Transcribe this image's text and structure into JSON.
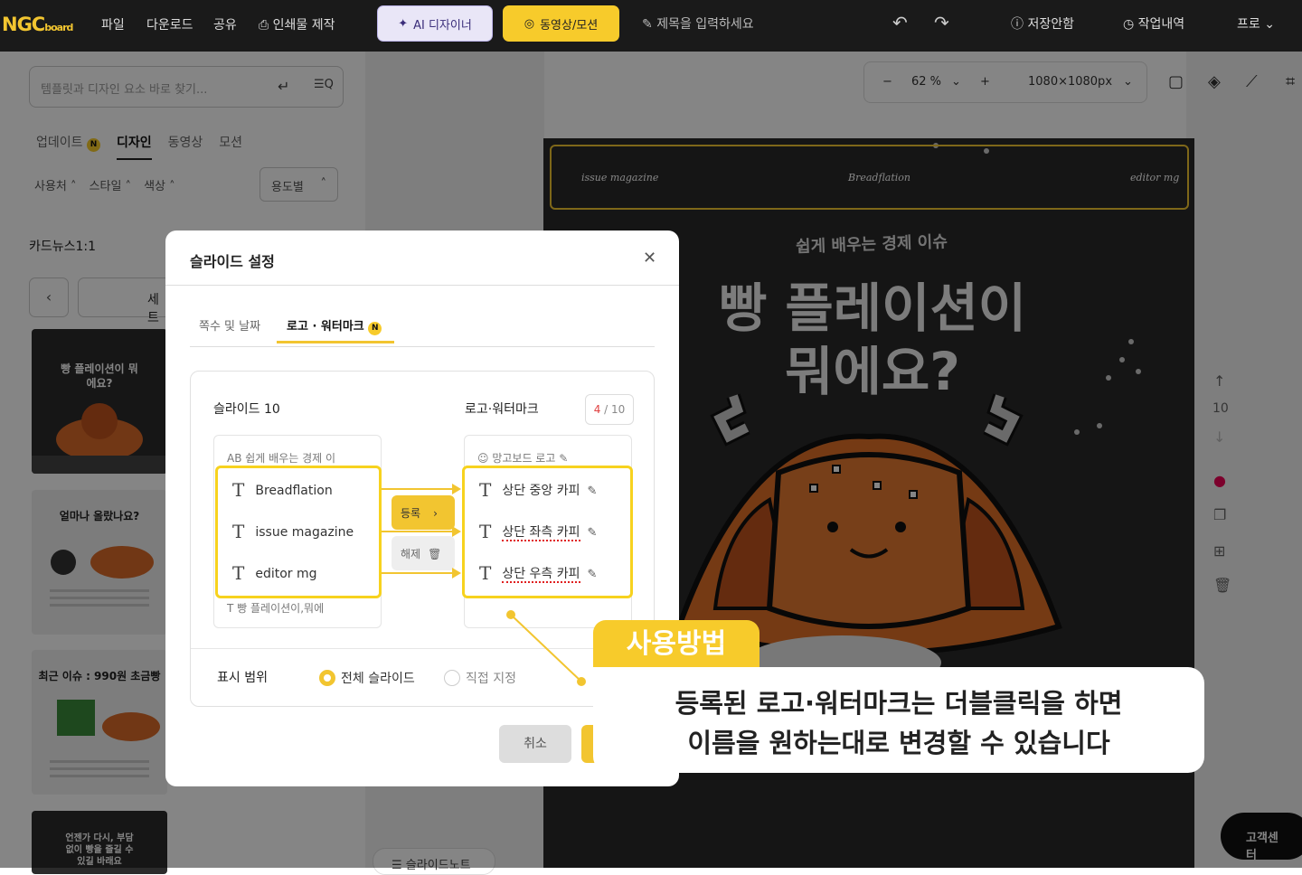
{
  "topbar": {
    "logo_main": "NGC",
    "logo_sub": "board",
    "menu": [
      "파일",
      "다운로드",
      "공유",
      "인쇄물 제작"
    ],
    "ai_designer": "AI 디자이너",
    "video_motion": "동영상/모션",
    "title_placeholder": "제목을 입력하세요",
    "not_saved": "저장안함",
    "history": "작업내역",
    "pro": "프로"
  },
  "sidebar": {
    "search_placeholder": "템플릿과 디자인 요소 바로 찾기...",
    "tabs": [
      "업데이트",
      "디자인",
      "동영상",
      "모션"
    ],
    "tab_badge": "N",
    "filters": [
      "사용처",
      "스타일",
      "색상"
    ],
    "usage": "용도별",
    "category": "카드뉴스1:1",
    "set_label": "세트",
    "thumbs": [
      {
        "title": "빵 플레이션이 뭐에요?"
      },
      {
        "title": "얼마나 올랐나요?"
      },
      {
        "title": "최근 이슈 : 990원 초금빵"
      },
      {
        "title": "언젠가 다시, 부담 없이 빵을 즐길 수 있길 바래요"
      }
    ]
  },
  "canvas": {
    "zoom": "62 %",
    "size": "1080×1080px",
    "logo_left": "issue magazine",
    "logo_center": "Breadflation",
    "logo_right": "editor mg",
    "subtitle": "쉽게 배우는 경제 이슈",
    "title_line1": "빵 플레이션이",
    "title_line2": "뭐에요?",
    "page_num": "10",
    "slide_note": "슬라이드노트",
    "help": "고객센터"
  },
  "modal": {
    "title": "슬라이드 설정",
    "tabs": [
      "쪽수 및 날짜",
      "로고 · 워터마크"
    ],
    "tab_badge": "N",
    "slide_col": "슬라이드 10",
    "logo_col": "로고·워터마크",
    "count_used": "4",
    "count_total": "/ 10",
    "slide_items_bg": [
      "쉽게 배우는 경제 이",
      "빵 플레이션이,뭐에"
    ],
    "logo_item_bg": "망고보드 로고",
    "register": "등록",
    "remove": "해제",
    "range_label": "표시 범위",
    "range_all": "전체 슬라이드",
    "range_custom": "직접 지정",
    "cancel": "취소",
    "left_items": [
      "Breadflation",
      "issue magazine",
      "editor mg"
    ],
    "right_items": [
      "상단 중앙 카피",
      "상단 좌측 카피",
      "상단 우측 카피"
    ]
  },
  "tip": {
    "label": "사용방법",
    "line1": "등록된 로고·워터마크는 더블클릭을 하면",
    "line2": "이름을 원하는대로 변경할 수 있습니다"
  },
  "colors": {
    "accent": "#f7cb2b",
    "dark": "#1a1a1a",
    "slide_bg": "#2a2a2a",
    "croissant": "#d86a2a"
  }
}
